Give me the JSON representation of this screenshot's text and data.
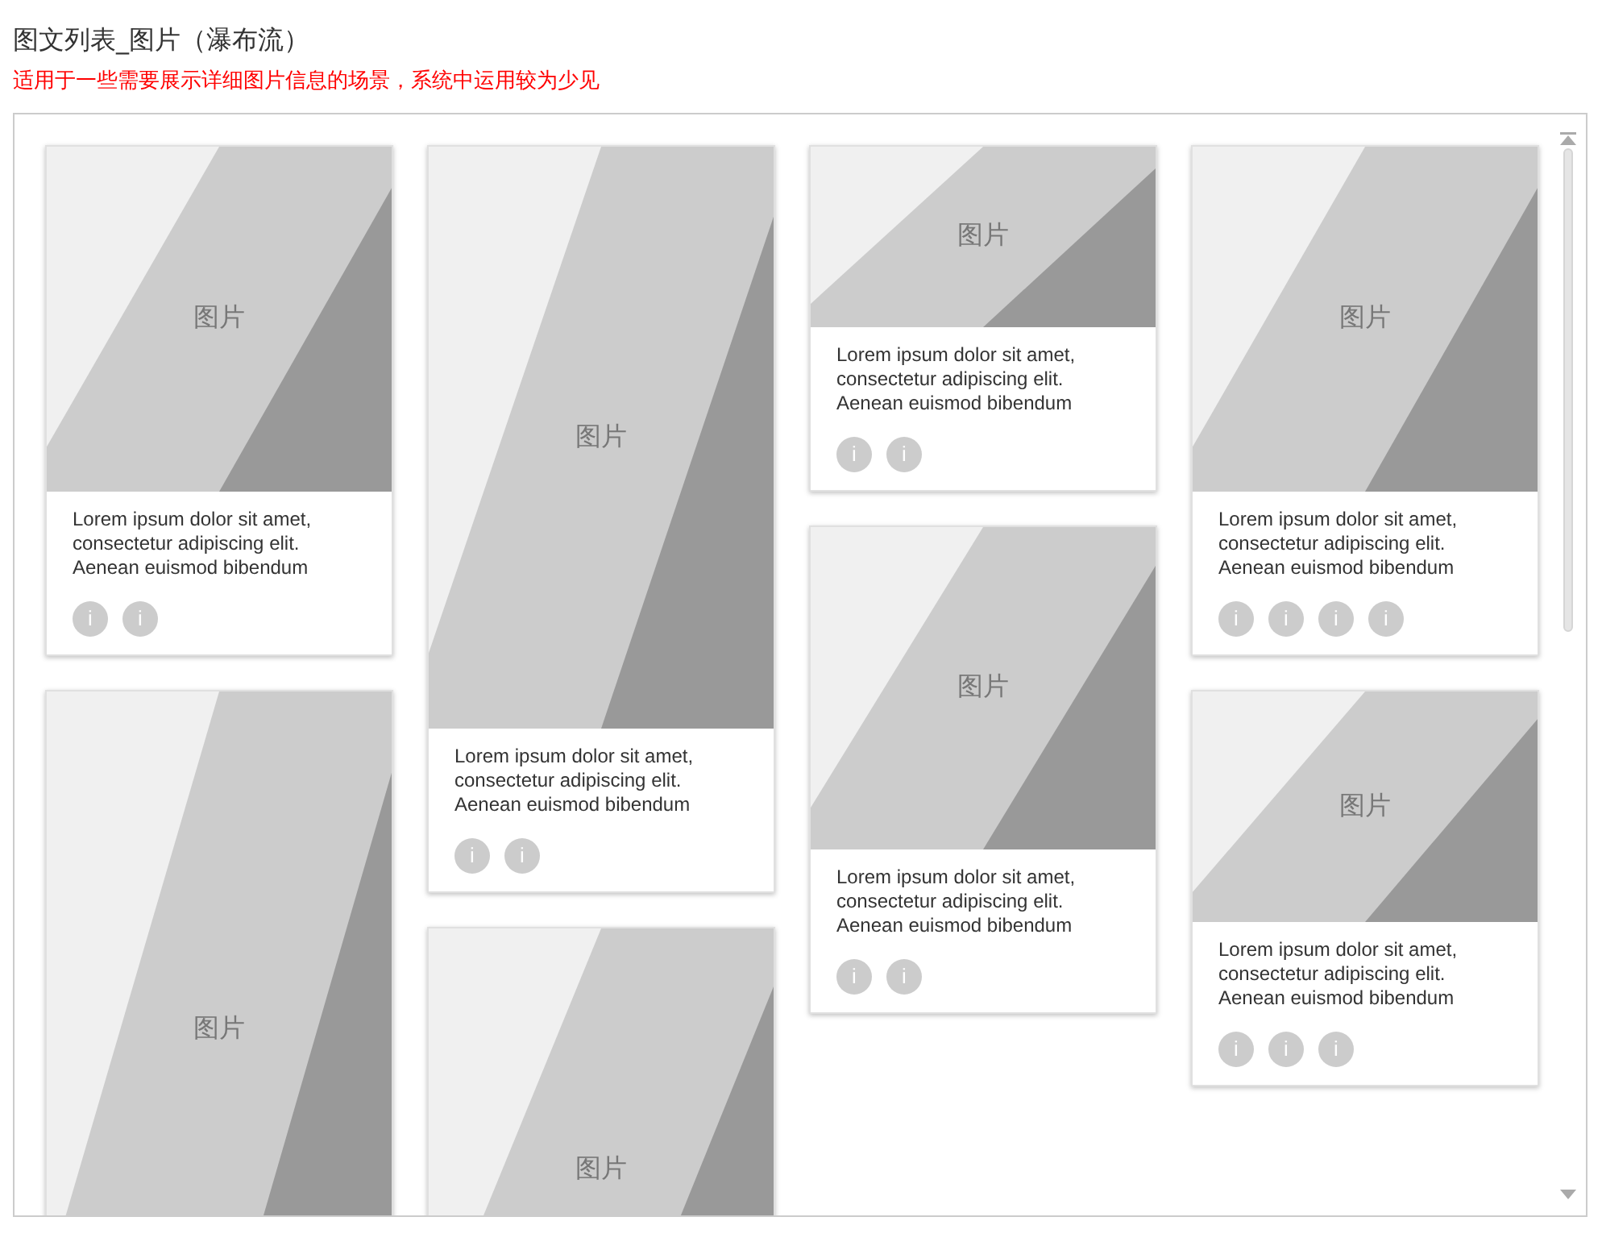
{
  "title": "图文列表_图片（瀑布流）",
  "subtitle": "适用于一些需要展示详细图片信息的场景，系统中运用较为少见",
  "columns": [
    [
      {
        "image_label": "图片",
        "text": "Lorem ipsum dolor sit amet, consectetur adipiscing elit. Aenean euismod bibendum",
        "icons": [
          "i",
          "i"
        ]
      },
      {
        "image_label": "图片"
      }
    ],
    [
      {
        "image_label": "图片",
        "text": "Lorem ipsum dolor sit amet, consectetur adipiscing elit. Aenean euismod bibendum",
        "icons": [
          "i",
          "i"
        ]
      },
      {
        "image_label": "图片"
      }
    ],
    [
      {
        "image_label": "图片",
        "text": "Lorem ipsum dolor sit amet, consectetur adipiscing elit. Aenean euismod bibendum",
        "icons": [
          "i",
          "i"
        ]
      },
      {
        "image_label": "图片",
        "text": "Lorem ipsum dolor sit amet, consectetur adipiscing elit. Aenean euismod bibendum",
        "icons": [
          "i",
          "i"
        ]
      }
    ],
    [
      {
        "image_label": "图片",
        "text": "Lorem ipsum dolor sit amet, consectetur adipiscing elit. Aenean euismod bibendum",
        "icons": [
          "i",
          "i",
          "i",
          "i"
        ]
      },
      {
        "image_label": "图片",
        "text": "Lorem ipsum dolor sit amet, consectetur adipiscing elit. Aenean euismod bibendum",
        "icons": [
          "i",
          "i",
          "i"
        ]
      }
    ]
  ]
}
